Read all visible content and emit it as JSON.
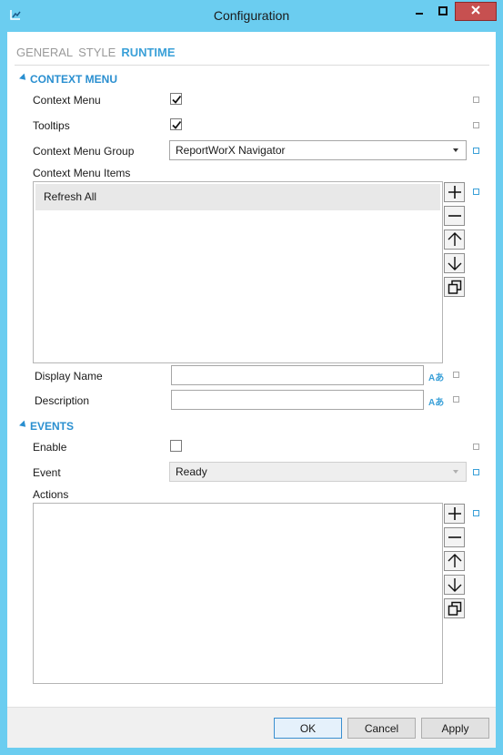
{
  "window": {
    "title": "Configuration"
  },
  "tabs": [
    "GENERAL",
    "STYLE",
    "RUNTIME"
  ],
  "active_tab": "RUNTIME",
  "context_menu_section": {
    "title": "CONTEXT MENU",
    "context_menu_label": "Context Menu",
    "context_menu_checked": true,
    "tooltips_label": "Tooltips",
    "tooltips_checked": true,
    "group_label": "Context Menu Group",
    "group_value": "ReportWorX Navigator",
    "items_label": "Context Menu Items",
    "items": [
      "Refresh All"
    ],
    "display_name_label": "Display Name",
    "display_name_value": "",
    "description_label": "Description",
    "description_value": ""
  },
  "events_section": {
    "title": "EVENTS",
    "enable_label": "Enable",
    "enable_checked": false,
    "event_label": "Event",
    "event_value": "Ready",
    "actions_label": "Actions",
    "actions": []
  },
  "footer": {
    "ok_label": "OK",
    "cancel_label": "Cancel",
    "apply_label": "Apply"
  },
  "icons": {
    "lang_glyph": "Aあ"
  },
  "colors": {
    "titlebar": "#6bcdf0",
    "accent": "#3aa0d8",
    "close": "#c75050"
  }
}
